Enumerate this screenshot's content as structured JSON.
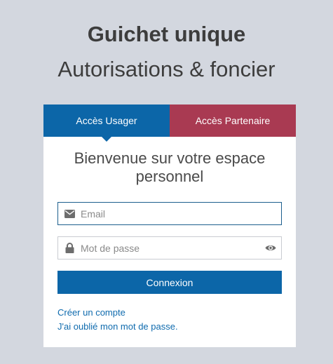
{
  "header": {
    "title": "Guichet unique",
    "subtitle": "Autorisations & foncier"
  },
  "tabs": [
    {
      "label": "Accès Usager",
      "active": true,
      "color": "#0c66a8"
    },
    {
      "label": "Accès Partenaire",
      "active": false,
      "color": "#a93a52"
    }
  ],
  "login": {
    "welcome": "Bienvenue sur votre espace personnel",
    "email": {
      "placeholder": "Email",
      "value": "",
      "icon": "envelope-icon"
    },
    "password": {
      "placeholder": "Mot de passe",
      "value": "",
      "icon": "lock-icon",
      "toggle_icon": "eye-icon"
    },
    "submit_label": "Connexion"
  },
  "links": {
    "create_account": "Créer un compte",
    "forgot_password": "J'ai oublié mon mot de passe."
  },
  "colors": {
    "background": "#d3d7df",
    "primary": "#0c66a8",
    "partner": "#a93a52",
    "link": "#0f6bae"
  }
}
